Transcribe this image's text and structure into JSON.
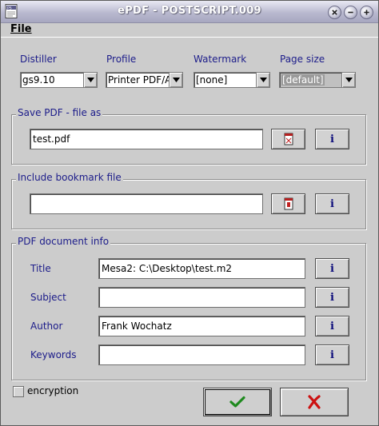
{
  "window": {
    "title": "ePDF - POSTSCRIPT.009"
  },
  "menu": {
    "file": "File"
  },
  "options": {
    "distiller": {
      "label": "Distiller",
      "value": "gs9.10"
    },
    "profile": {
      "label": "Profile",
      "value": "Printer PDF/A"
    },
    "watermark": {
      "label": "Watermark",
      "value": "[none]"
    },
    "page_size": {
      "label": "Page size",
      "value": "[default]",
      "disabled": true
    }
  },
  "save_pdf": {
    "group_title": "Save PDF - file as",
    "filename": "test.pdf"
  },
  "bookmark": {
    "group_title": "Include bookmark file",
    "filename": ""
  },
  "doc_info": {
    "group_title": "PDF document info",
    "fields": [
      {
        "label": "Title",
        "value": "Mesa2: C:\\Desktop\\test.m2"
      },
      {
        "label": "Subject",
        "value": ""
      },
      {
        "label": "Author",
        "value": "Frank Wochatz"
      },
      {
        "label": "Keywords",
        "value": ""
      }
    ]
  },
  "info_glyph": "i",
  "encryption": {
    "label": "encryption",
    "checked": false
  },
  "icons": {
    "system": "document-icon",
    "help": "help-icon",
    "minimize": "minimize-icon",
    "maximize": "maximize-icon",
    "ok": "checkmark-icon",
    "cancel": "cross-icon",
    "browse": "file-browse-icon"
  },
  "colors": {
    "label_text": "#1c1c8a",
    "ok_check": "#1f8a1f",
    "cancel_x": "#cc1111"
  }
}
